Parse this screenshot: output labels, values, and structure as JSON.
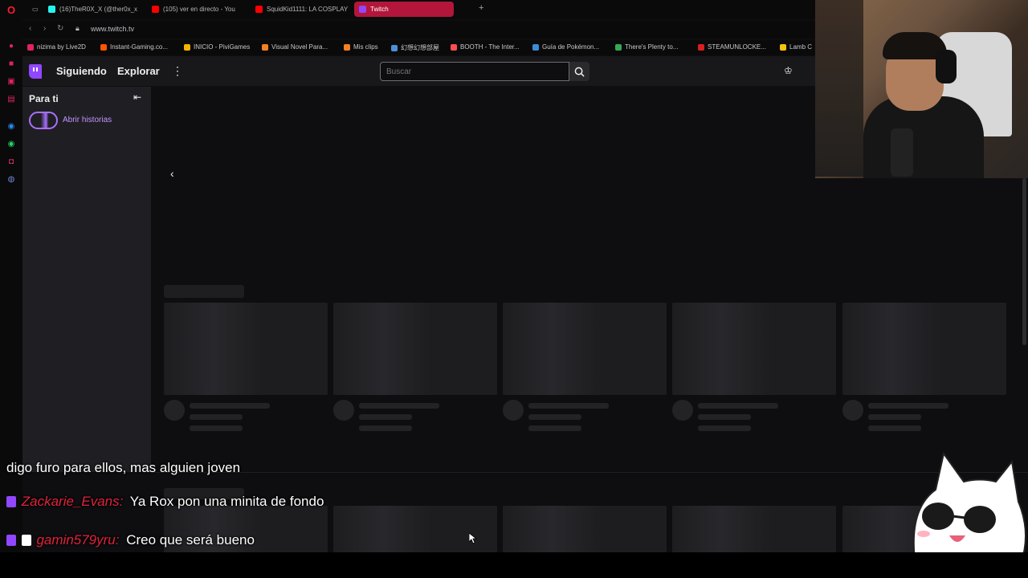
{
  "browser": {
    "tabs": [
      {
        "label": "(16)TheR0X_X (@ther0x_x",
        "color": "#25f4ee"
      },
      {
        "label": "(105) ver en directo - You",
        "color": "#ff0000"
      },
      {
        "label": "SquidKid1111: LA COSPLAY",
        "color": "#ff0000"
      },
      {
        "label": "Twitch",
        "color": "#9147ff",
        "active": true
      }
    ],
    "url": "www.twitch.tv",
    "bookmarks": [
      {
        "label": "nizima by Live2D",
        "color": "#e0245e"
      },
      {
        "label": "Instant-Gaming.co...",
        "color": "#ff5400"
      },
      {
        "label": "INICIO - PiviGames",
        "color": "#f4b400"
      },
      {
        "label": "Visual Novel Para...",
        "color": "#f48024"
      },
      {
        "label": "Mis clips",
        "color": "#f48024"
      },
      {
        "label": "幻想幻想部屋",
        "color": "#4a90d9"
      },
      {
        "label": "BOOTH - The Inter...",
        "color": "#fc4d50"
      },
      {
        "label": "Guía de Pokémon...",
        "color": "#3c8bd9"
      },
      {
        "label": "There's Plenty to...",
        "color": "#34a853"
      },
      {
        "label": "STEAMUNLOCKE...",
        "color": "#d92020"
      },
      {
        "label": "Lamb C",
        "color": "#f4c20d"
      }
    ]
  },
  "twitch": {
    "nav": {
      "following": "Siguiendo",
      "explore": "Explorar"
    },
    "search": {
      "placeholder": "Buscar"
    },
    "sidebar": {
      "title": "Para ti",
      "stories": "Abrir historias"
    }
  },
  "overlay": {
    "chat": [
      {
        "user": "",
        "message": "digo furo para ellos, mas alguien joven"
      },
      {
        "user": "Zackarie_Evans:",
        "message": "Ya Rox pon una minita de fondo"
      },
      {
        "user": "gamin579yru:",
        "message": "Creo que será bueno"
      }
    ]
  },
  "colors": {
    "accent": "#9147ff",
    "tab_active": "#b3163a",
    "bg": "#0e0e10",
    "sidebar": "#1f1f23"
  }
}
